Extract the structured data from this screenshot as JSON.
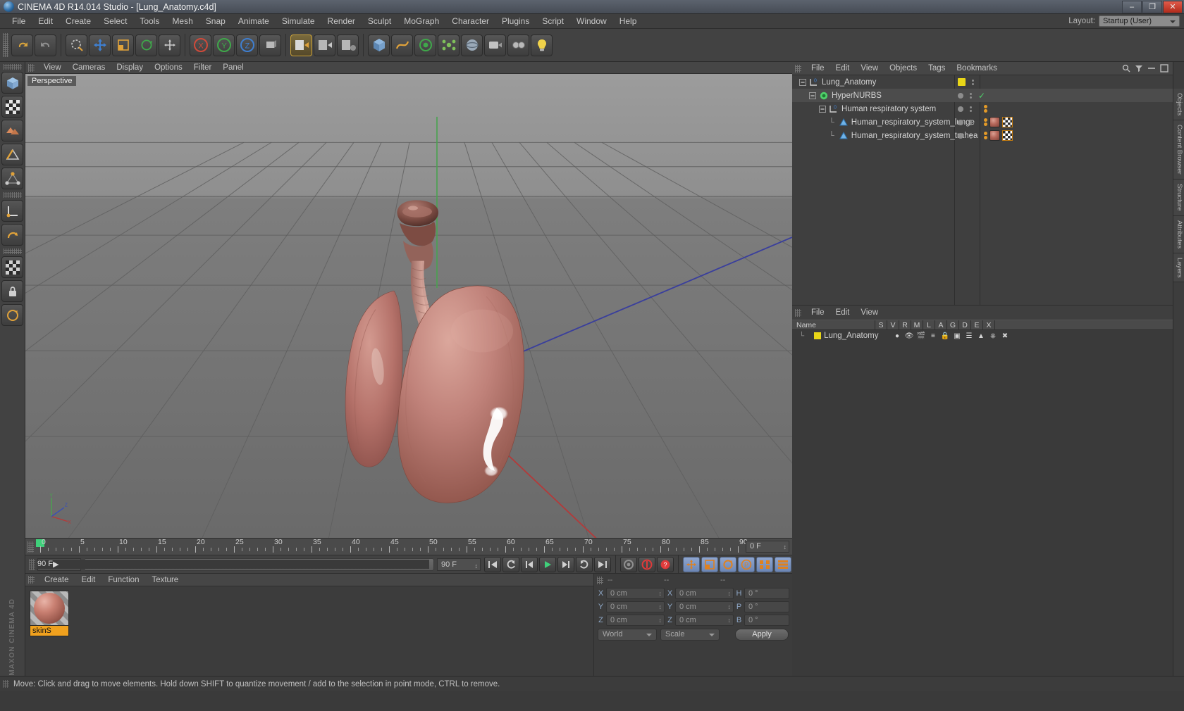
{
  "window": {
    "title": "CINEMA 4D R14.014 Studio - [Lung_Anatomy.c4d]",
    "minimize": "–",
    "maximize": "❐",
    "close": "✕"
  },
  "menubar": {
    "items": [
      "File",
      "Edit",
      "Create",
      "Select",
      "Tools",
      "Mesh",
      "Snap",
      "Animate",
      "Simulate",
      "Render",
      "Sculpt",
      "MoGraph",
      "Character",
      "Plugins",
      "Script",
      "Window",
      "Help"
    ],
    "layout_label": "Layout:",
    "layout_value": "Startup (User)"
  },
  "viewport": {
    "menu": [
      "View",
      "Cameras",
      "Display",
      "Options",
      "Filter",
      "Panel"
    ],
    "label": "Perspective",
    "axis": {
      "x": "X",
      "y": "Y",
      "z": "Z"
    }
  },
  "timeline": {
    "ticks": [
      "0",
      "5",
      "10",
      "15",
      "20",
      "25",
      "30",
      "35",
      "40",
      "45",
      "50",
      "55",
      "60",
      "65",
      "70",
      "75",
      "80",
      "85",
      "90"
    ],
    "current_frame": "0 F",
    "end_field": "0 F",
    "start_field": "0 F",
    "range_end": "90 F",
    "fps_field": "90 F"
  },
  "material_manager": {
    "menu": [
      "Create",
      "Edit",
      "Function",
      "Texture"
    ],
    "materials": [
      {
        "name": "skinS"
      }
    ]
  },
  "coordinates": {
    "headers": [
      "--",
      "--",
      "--"
    ],
    "rows": [
      {
        "pos_label": "X",
        "pos_value": "0 cm",
        "size_label": "X",
        "size_value": "0 cm",
        "rot_label": "H",
        "rot_value": "0 °"
      },
      {
        "pos_label": "Y",
        "pos_value": "0 cm",
        "size_label": "Y",
        "size_value": "0 cm",
        "rot_label": "P",
        "rot_value": "0 °"
      },
      {
        "pos_label": "Z",
        "pos_value": "0 cm",
        "size_label": "Z",
        "size_value": "0 cm",
        "rot_label": "B",
        "rot_value": "0 °"
      }
    ],
    "space": "World",
    "mode": "Scale",
    "apply": "Apply"
  },
  "object_manager": {
    "menu": [
      "File",
      "Edit",
      "View",
      "Objects",
      "Tags",
      "Bookmarks"
    ],
    "rows": [
      {
        "name": "Lung_Anatomy",
        "indent": 0,
        "icon": "null-object-icon",
        "selected": false
      },
      {
        "name": "HyperNURBS",
        "indent": 1,
        "icon": "hypernurbs-icon",
        "selected": true
      },
      {
        "name": "Human respiratory system",
        "indent": 2,
        "icon": "null-object-icon",
        "selected": false
      },
      {
        "name": "Human_respiratory_system_lunge",
        "indent": 3,
        "icon": "polygon-object-icon",
        "selected": false
      },
      {
        "name": "Human_respiratory_system_trahea",
        "indent": 3,
        "icon": "polygon-object-icon",
        "selected": false
      }
    ]
  },
  "layer_manager": {
    "menu": [
      "File",
      "Edit",
      "View"
    ],
    "columns": [
      "Name",
      "S",
      "V",
      "R",
      "M",
      "L",
      "A",
      "G",
      "D",
      "E",
      "X"
    ],
    "rows": [
      {
        "name": "Lung_Anatomy"
      }
    ]
  },
  "right_dock_tabs": [
    "Objects",
    "Content Browser",
    "Structure",
    "Attributes",
    "Layers"
  ],
  "status": {
    "message": "Move: Click and drag to move elements. Hold down SHIFT to quantize movement / add to the selection in point mode, CTRL to remove."
  },
  "brand": {
    "line1": "MAXON",
    "line2": "CINEMA 4D"
  },
  "colors": {
    "accent_orange": "#f0a11e",
    "accent_yellow": "#e9d617",
    "selection_blue": "#8fa6cf",
    "green_play": "#3fd07a",
    "red_record": "#e03a3a"
  }
}
